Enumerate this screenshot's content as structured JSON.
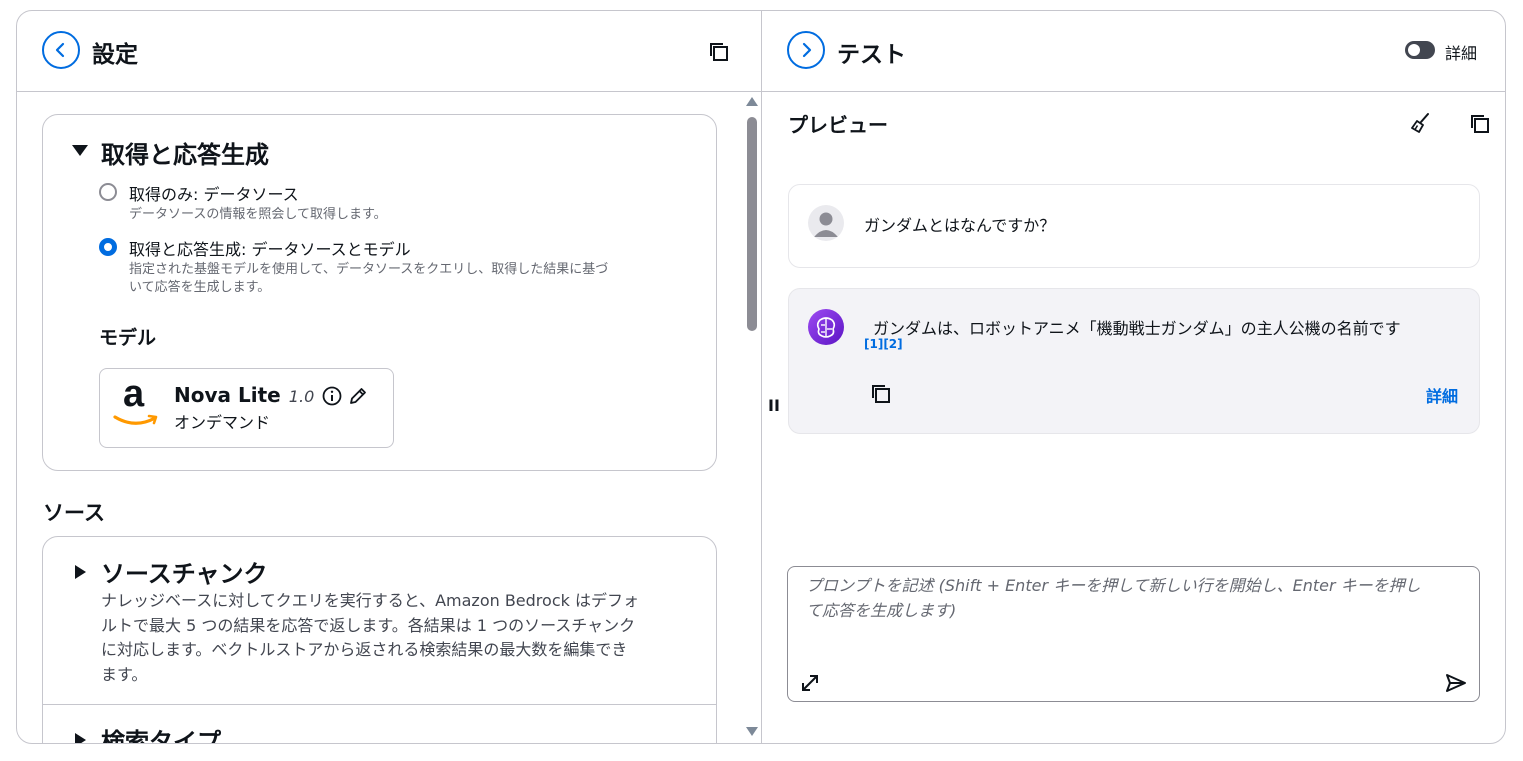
{
  "left_panel": {
    "title": "設定",
    "back_icon": "chevron-left-icon",
    "copy_icon": "copy-icon",
    "retrieval_section": {
      "title": "取得と応答生成",
      "options": [
        {
          "label": "取得のみ: データソース",
          "description": "データソースの情報を照会して取得します。",
          "selected": false
        },
        {
          "label": "取得と応答生成: データソースとモデル",
          "description_line1": "指定された基盤モデルを使用して、データソースをクエリし、取得した結果に基づ",
          "description_line2": "いて応答を生成します。",
          "selected": true
        }
      ],
      "model_heading": "モデル",
      "model": {
        "logo": "amazon-logo-icon",
        "logo_letter": "a",
        "name": "Nova Lite",
        "version": "1.0",
        "mode": "オンデマンド"
      }
    },
    "source_heading": "ソース",
    "source_chunk": {
      "title": "ソースチャンク",
      "desc_lines": [
        "ナレッジベースに対してクエリを実行すると、Amazon Bedrock はデフォ",
        "ルトで最大 5 つの結果を応答で返します。各結果は 1 つのソースチャンク",
        "に対応します。ベクトルストアから返される検索結果の最大数を編集でき",
        "ます。"
      ]
    },
    "search_type": {
      "title": "検索タイプ"
    }
  },
  "right_panel": {
    "title": "テスト",
    "forward_icon": "chevron-right-icon",
    "toggle_label": "詳細",
    "toggle_on": false,
    "preview_title": "プレビュー",
    "user_message": "ガンダムとはなんですか？",
    "assistant_message": "ガンダムは、ロボットアニメ「機動戦士ガンダム」の主人公機の名前です",
    "citations": "[1][2]",
    "details_link": "詳細",
    "prompt_placeholder_line1": "プロンプトを記述 (Shift + Enter キーを押して新しい行を開始し、Enter キーを押し",
    "prompt_placeholder_line2": "て応答を生成します)"
  },
  "divider_handle": "II",
  "colors": {
    "accent": "#006ce0",
    "border": "#c6c6cd",
    "muted_text": "#656871",
    "assistant_bg": "#f3f3f7",
    "amazon_orange": "#ff9900"
  }
}
